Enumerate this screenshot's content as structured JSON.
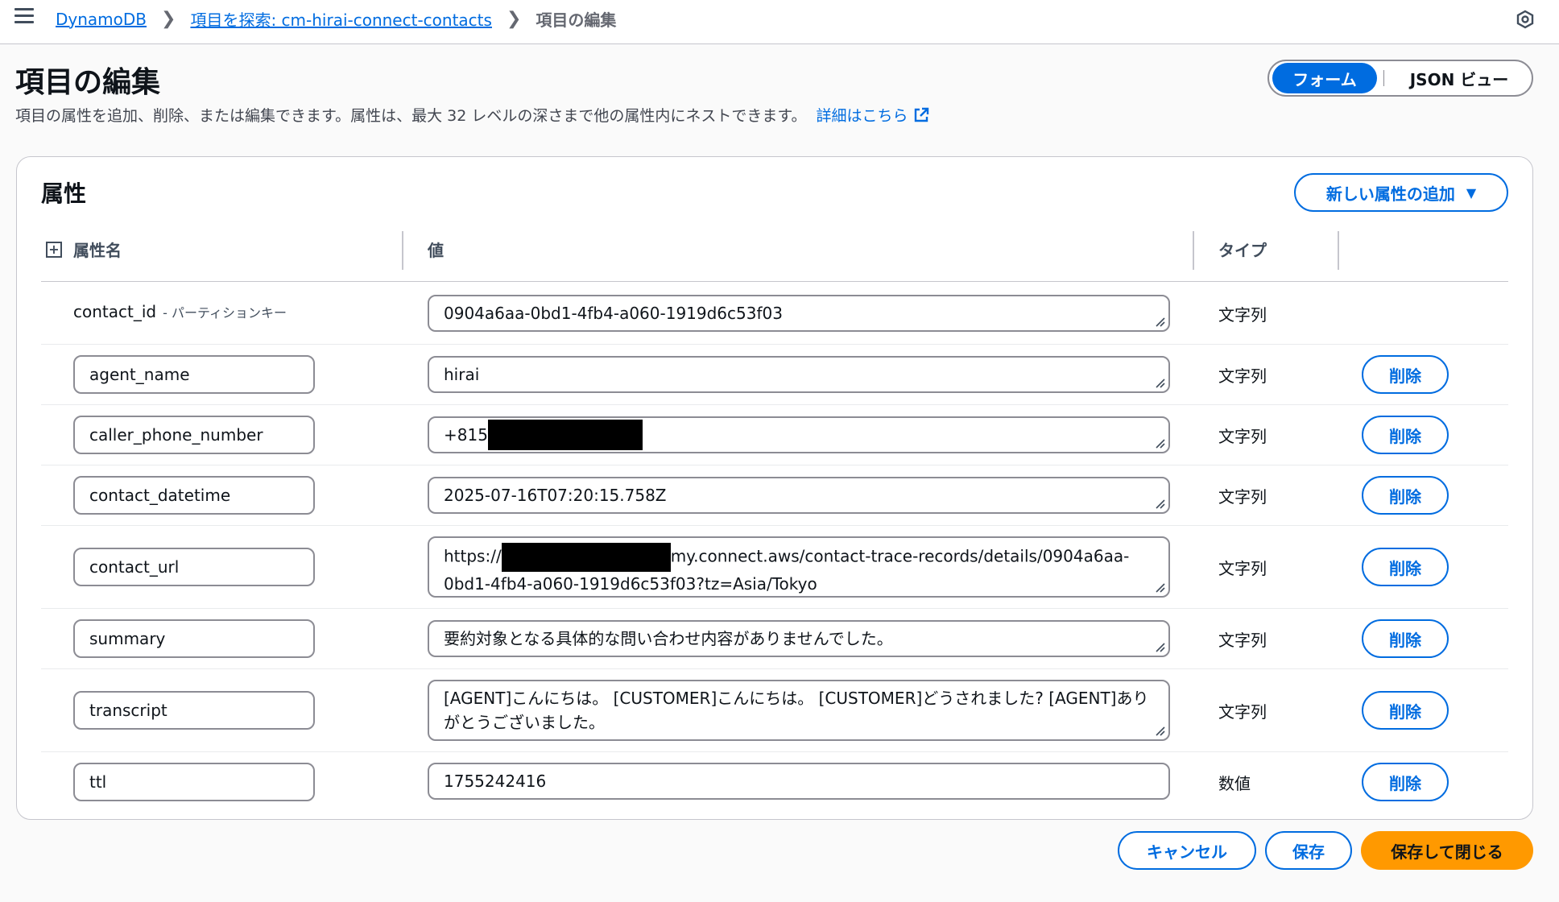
{
  "nav": {
    "breadcrumb": [
      "DynamoDB",
      "項目を探索: cm-hirai-connect-contacts",
      "項目の編集"
    ]
  },
  "header": {
    "title": "項目の編集",
    "description": "項目の属性を追加、削除、または編集できます。属性は、最大 32 レベルの深さまで他の属性内にネストできます。",
    "learn_more": "詳細はこちら",
    "view_toggle": {
      "form": "フォーム",
      "json": "JSON ビュー",
      "selected": "フォーム"
    }
  },
  "attributes": {
    "section_title": "属性",
    "add_button": "新しい属性の追加",
    "columns": {
      "name": "属性名",
      "value": "値",
      "type": "タイプ"
    },
    "partition_key_label": "- パーティションキー",
    "delete_label": "削除",
    "rows": [
      {
        "name": "contact_id",
        "value": "0904a6aa-0bd1-4fb4-a060-1919d6c53f03",
        "type": "文字列"
      },
      {
        "name": "agent_name",
        "value": "hirai",
        "type": "文字列"
      },
      {
        "name": "caller_phone_number",
        "value_prefix": "+815",
        "type": "文字列"
      },
      {
        "name": "contact_datetime",
        "value": "2025-07-16T07:20:15.758Z",
        "type": "文字列"
      },
      {
        "name": "contact_url",
        "value_prefix": "https://",
        "value_suffix_line1": "my.connect.aws/contact-trace-records/details/0904a6aa-",
        "value_line2": "0bd1-4fb4-a060-1919d6c53f03?tz=Asia/Tokyo",
        "type": "文字列"
      },
      {
        "name": "summary",
        "value": "要約対象となる具体的な問い合わせ内容がありませんでした。",
        "type": "文字列"
      },
      {
        "name": "transcript",
        "value_line1": "[AGENT]こんにちは。 [CUSTOMER]こんにちは。 [CUSTOMER]どうされました? [AGENT]ありがとうございました。",
        "type": "文字列"
      },
      {
        "name": "ttl",
        "value": "1755242416",
        "type": "数値"
      }
    ]
  },
  "footer": {
    "cancel": "キャンセル",
    "save": "保存",
    "save_close": "保存して閉じる"
  }
}
